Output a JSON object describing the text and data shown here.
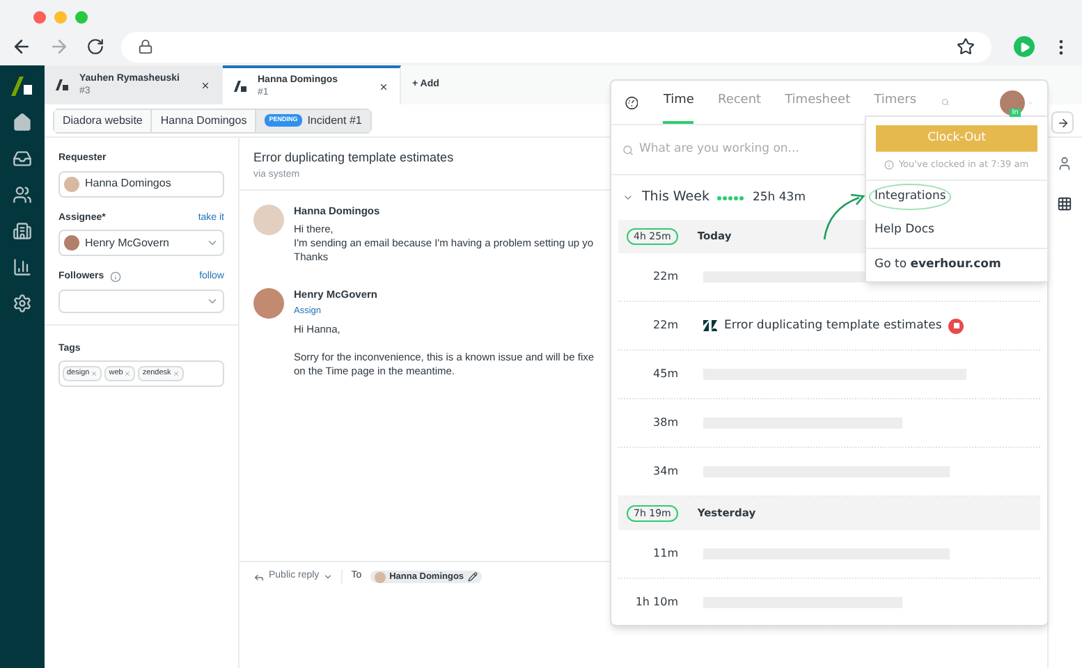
{
  "tabs": [
    {
      "title": "Yauhen Rymasheuski",
      "number": "#3",
      "selected": false
    },
    {
      "title": "Hanna Domingos",
      "number": "#1",
      "selected": true
    }
  ],
  "add_tab": "+ Add",
  "breadcrumb": [
    {
      "kind": "crumb",
      "label": "Diadora website"
    },
    {
      "kind": "crumb",
      "label": "Hanna Domingos"
    },
    {
      "kind": "status",
      "badge": "PENDING",
      "label": "Incident #1"
    }
  ],
  "fields": {
    "requester": {
      "label": "Requester",
      "value": "Hanna Domingos"
    },
    "assignee": {
      "label": "Assignee*",
      "action": "take it",
      "value": "Henry McGovern"
    },
    "followers": {
      "label": "Followers",
      "action": "follow"
    },
    "tags": {
      "label": "Tags",
      "items": [
        "design",
        "web",
        "zendesk"
      ]
    }
  },
  "conversation": {
    "title": "Error duplicating template estimates",
    "via": "via system",
    "messages": [
      {
        "author": "Hanna Domingos",
        "paragraphs": [
          [
            "Hi there,",
            "I'm sending an email because I'm having a problem setting up yo",
            "Thanks"
          ]
        ]
      },
      {
        "author": "Henry McGovern",
        "assign": "Assign",
        "paragraphs": [
          [
            "Hi Hanna,"
          ],
          [
            "Sorry for the inconvenience, this is a known issue and will be fixe",
            "on the Time page in the meantime."
          ]
        ]
      }
    ]
  },
  "reply": {
    "mode": "Public reply",
    "to": "To",
    "recipient": "Hanna Domingos"
  },
  "everhour": {
    "tabs": [
      {
        "label": "Time",
        "selected": true
      },
      {
        "label": "Recent",
        "selected": false
      },
      {
        "label": "Timesheet",
        "selected": false
      },
      {
        "label": "Timers",
        "selected": false
      }
    ],
    "user_badge": "In",
    "search_placeholder": "What are you working on...",
    "week": {
      "label": "This Week",
      "total": "25h 43m"
    },
    "days": [
      {
        "total": "4h 25m",
        "label": "Today",
        "entries": [
          {
            "duration": "22m",
            "kind": "blank"
          },
          {
            "duration": "22m",
            "kind": "task",
            "title": "Error duplicating template estimates"
          },
          {
            "duration": "45m",
            "kind": "blank"
          },
          {
            "duration": "38m",
            "kind": "blank"
          },
          {
            "duration": "34m",
            "kind": "blank"
          }
        ]
      },
      {
        "total": "7h 19m",
        "label": "Yesterday",
        "entries": [
          {
            "duration": "11m",
            "kind": "blank"
          },
          {
            "duration": "1h 10m",
            "kind": "blank"
          }
        ]
      }
    ],
    "menu": {
      "clock_out": "Clock-Out",
      "note": "You've clocked in at 7:39 am",
      "items": [
        {
          "label": "Integrations",
          "highlighted": true
        },
        {
          "label": "Help Docs",
          "highlighted": false
        },
        {
          "label": "Go to **everhour.com**",
          "highlighted": false
        }
      ]
    }
  }
}
